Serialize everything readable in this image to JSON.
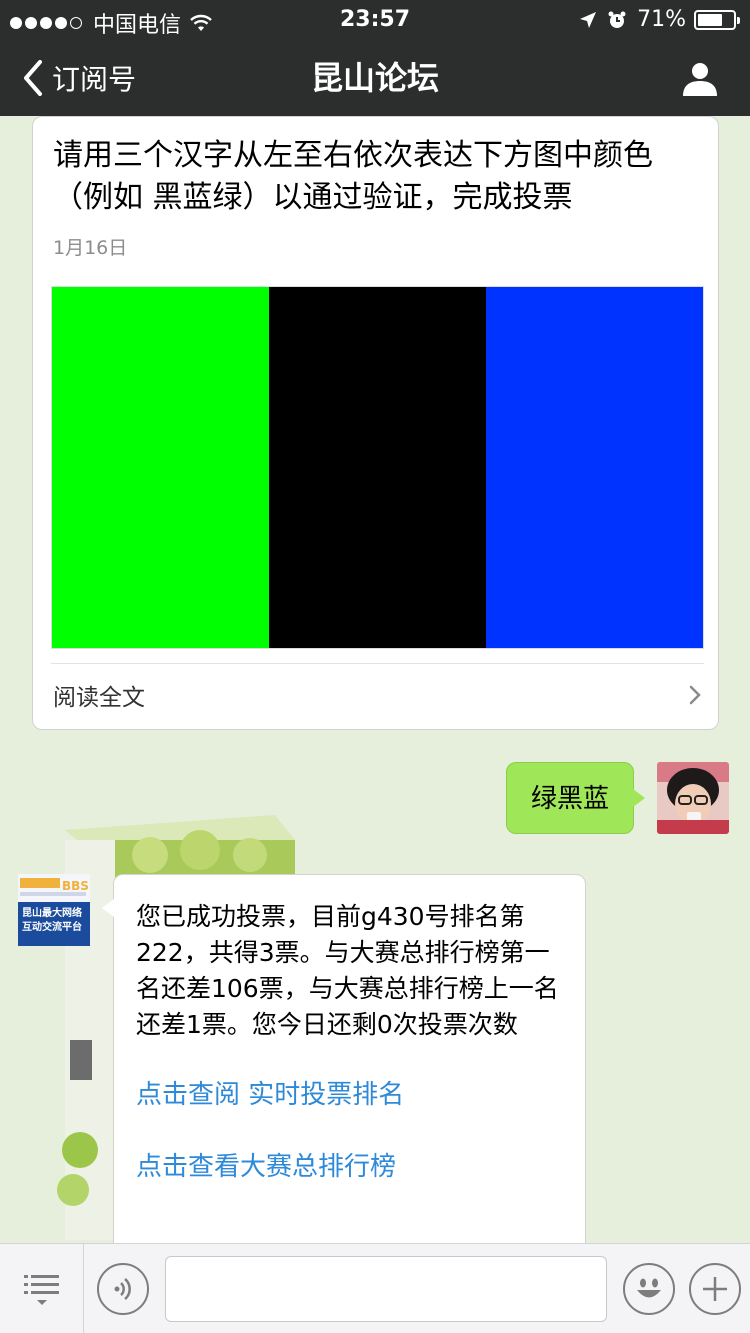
{
  "status_bar": {
    "carrier": "中国电信",
    "time": "23:57",
    "battery_percent": "71%",
    "battery_level": 0.71,
    "signal_bars_filled": 4,
    "signal_bars_total": 5
  },
  "nav": {
    "back_label": "订阅号",
    "title": "昆山论坛"
  },
  "article": {
    "title": "请用三个汉字从左至右依次表达下方图中颜色（例如 黑蓝绿）以通过验证，完成投票",
    "date": "1月16日",
    "image_colors": [
      "#00ff00",
      "#000000",
      "#0033ff"
    ],
    "read_more": "阅读全文"
  },
  "outgoing_message": {
    "text": "绿黑蓝"
  },
  "incoming_message": {
    "text": "您已成功投票，目前g430号排名第222，共得3票。与大赛总排行榜第一名还差106票，与大赛总排行榜上一名还差1票。您今日还剩0次投票次数",
    "link1": "点击查阅 实时投票排名",
    "link2": "点击查看大赛总排行榜",
    "avatar_text_top": "昆山论坛 BBS",
    "avatar_text_bottom": "昆山最大网络互动交流平台"
  },
  "colors": {
    "nav_bg": "#2b2e2c",
    "chat_bg": "#e6efdc",
    "outgoing_bubble": "#9fe658",
    "link": "#2e8ad8"
  }
}
